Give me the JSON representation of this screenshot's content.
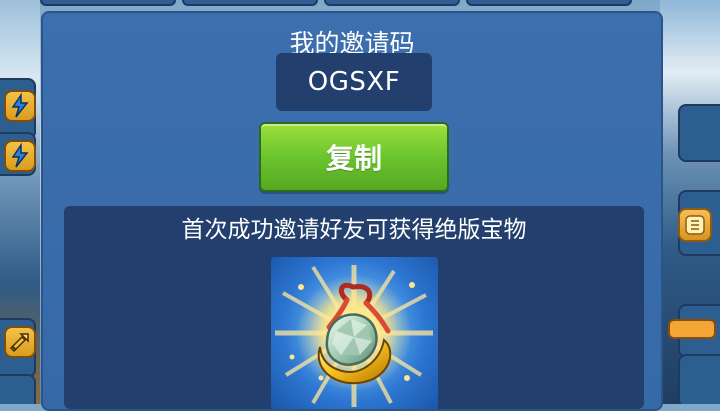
{
  "panel": {
    "title": "我的邀请码",
    "invite_code": "OGSXF",
    "copy_button_label": "复制",
    "reward_text": "首次成功邀请好友可获得绝版宝物"
  },
  "scene": {
    "left_icons": [
      "lightning-icon",
      "lightning-icon",
      "sword-icon"
    ],
    "right_icons": [
      "badge-icon",
      "bar-icon"
    ]
  },
  "reward_item": {
    "icon": "amulet-icon"
  },
  "colors": {
    "panel_blue": "#3a6eab",
    "dark_blue": "#223f6d",
    "green_button": "#6bc52d"
  }
}
